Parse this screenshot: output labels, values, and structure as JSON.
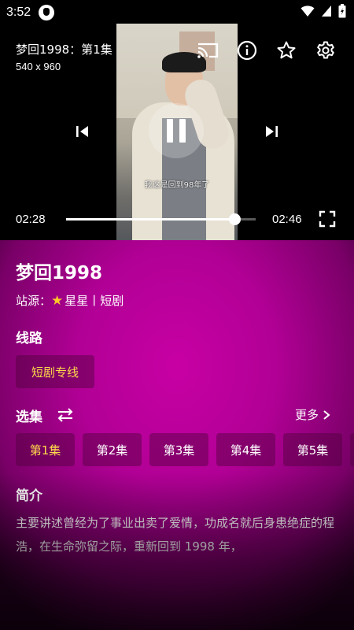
{
  "status_bar": {
    "time": "3:52"
  },
  "player": {
    "title": "梦回1998：第1集",
    "resolution": "540 x 960",
    "subtitle": "我这是回到98年了",
    "current_time": "02:28",
    "duration": "02:46",
    "progress_fraction": 0.89
  },
  "detail": {
    "title": "梦回1998",
    "source_label": "站源：",
    "source_name": "星星丨短剧",
    "route_heading": "线路",
    "route_chip": "短剧专线",
    "episodes_heading": "选集",
    "more_label": "更多",
    "episodes": [
      "第1集",
      "第2集",
      "第3集",
      "第4集",
      "第5集"
    ],
    "synopsis_heading": "简介",
    "synopsis": "主要讲述曾经为了事业出卖了爱情，功成名就后身患绝症的程浩，在生命弥留之际，重新回到 1998 年，"
  },
  "colors": {
    "accent_yellow": "#ffd94a",
    "panel_magenta": "#c800a4"
  }
}
